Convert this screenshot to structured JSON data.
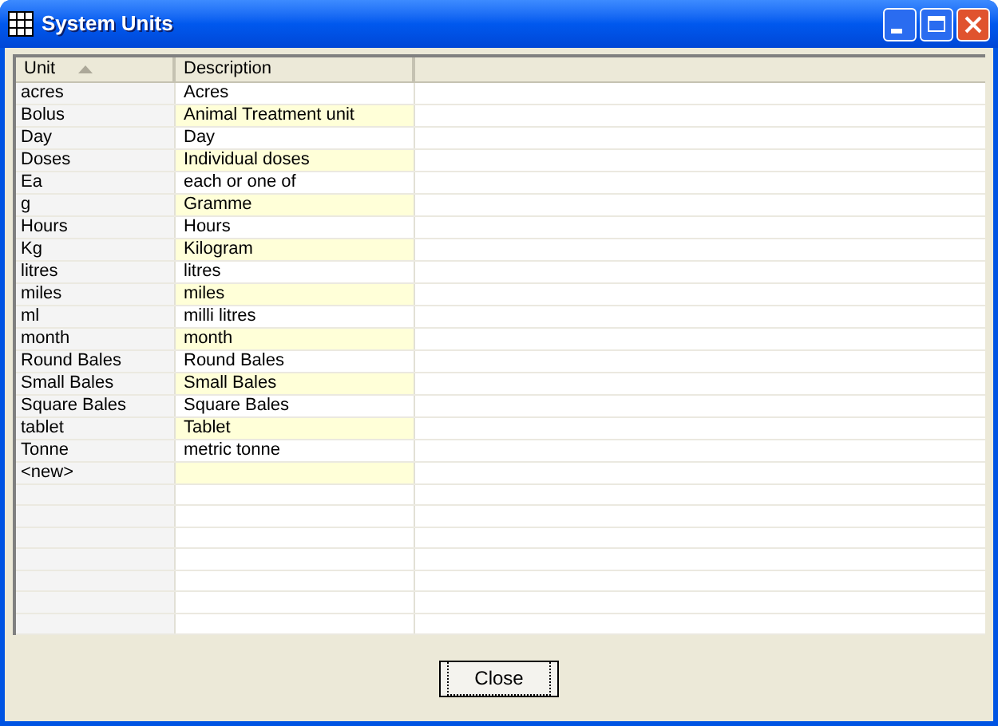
{
  "window": {
    "title": "System Units"
  },
  "table": {
    "columns": [
      {
        "label": "Unit",
        "sorted": true
      },
      {
        "label": "Description",
        "sorted": false
      }
    ],
    "rows": [
      {
        "unit": "acres",
        "description": "Acres"
      },
      {
        "unit": "Bolus",
        "description": "Animal Treatment unit"
      },
      {
        "unit": "Day",
        "description": "Day"
      },
      {
        "unit": "Doses",
        "description": "Individual doses"
      },
      {
        "unit": "Ea",
        "description": "each or one of"
      },
      {
        "unit": "g",
        "description": "Gramme"
      },
      {
        "unit": "Hours",
        "description": "Hours"
      },
      {
        "unit": "Kg",
        "description": "Kilogram"
      },
      {
        "unit": "litres",
        "description": "litres"
      },
      {
        "unit": "miles",
        "description": "miles"
      },
      {
        "unit": "ml",
        "description": "milli litres"
      },
      {
        "unit": "month",
        "description": "month"
      },
      {
        "unit": "Round Bales",
        "description": "Round Bales"
      },
      {
        "unit": "Small Bales",
        "description": "Small Bales"
      },
      {
        "unit": "Square Bales",
        "description": "Square Bales"
      },
      {
        "unit": "tablet",
        "description": "Tablet"
      },
      {
        "unit": "Tonne",
        "description": "metric tonne"
      }
    ],
    "new_row": {
      "unit": "<new>"
    }
  },
  "buttons": [
    {
      "label": "Close"
    }
  ]
}
